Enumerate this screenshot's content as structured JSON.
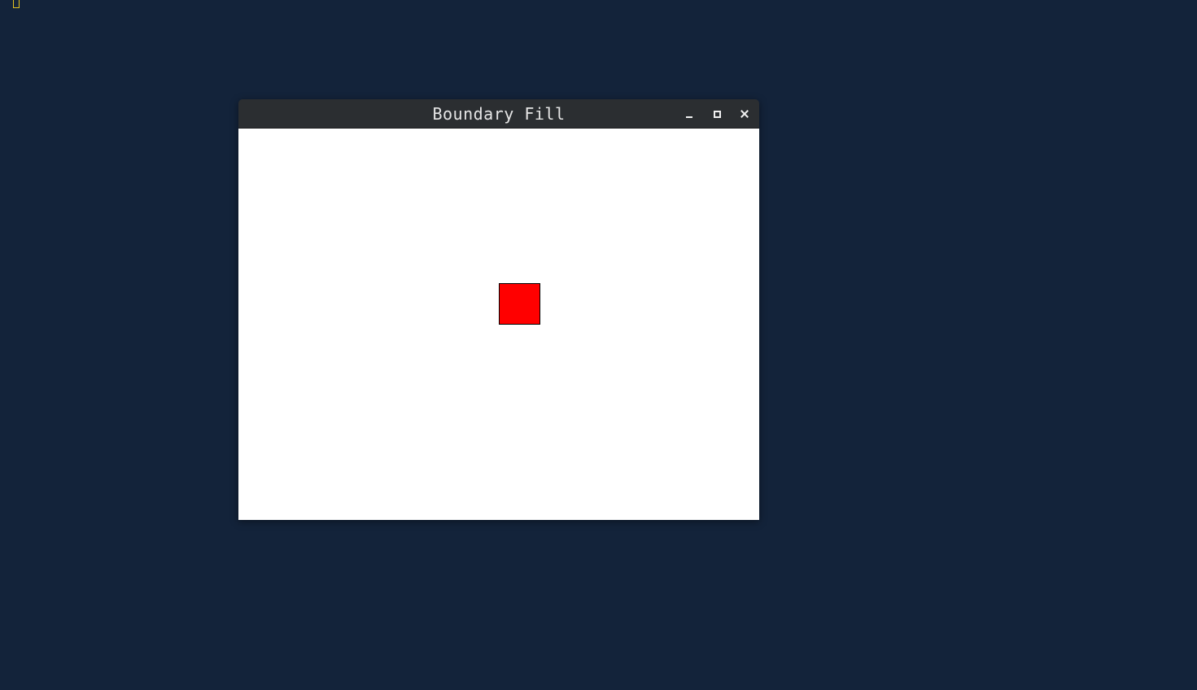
{
  "window": {
    "title": "Boundary Fill"
  },
  "canvas": {
    "background_color": "#ffffff",
    "shape": {
      "type": "square",
      "fill_color": "#ff0000",
      "boundary_color": "#000000"
    }
  },
  "controls": {
    "minimize_icon": "minimize-icon",
    "maximize_icon": "maximize-icon",
    "close_icon": "close-icon"
  },
  "desktop": {
    "background_color": "#13233a",
    "indicator_color": "#e3c220"
  }
}
